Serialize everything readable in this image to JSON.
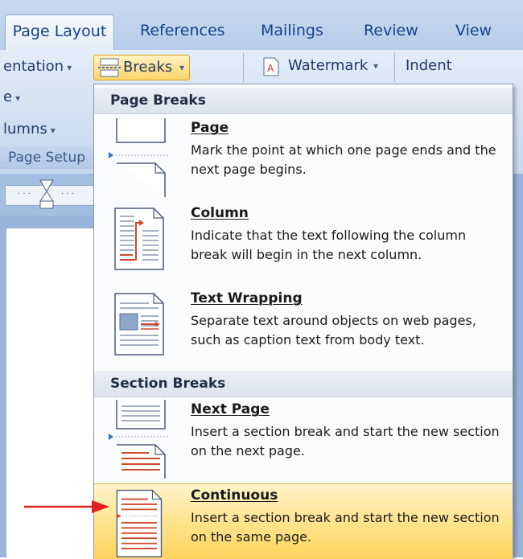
{
  "tabs": [
    {
      "label": "Page Layout",
      "active": true
    },
    {
      "label": "References"
    },
    {
      "label": "Mailings"
    },
    {
      "label": "Review"
    },
    {
      "label": "View"
    }
  ],
  "ribbon": {
    "orientation_label": "entation",
    "size_label": "e",
    "columns_label": "lumns",
    "breaks_label": "Breaks",
    "watermark_label": "Watermark",
    "indent_label": "Indent",
    "group_label": "Page Setup",
    "caret": "▾"
  },
  "menu": {
    "page_breaks_header": "Page Breaks",
    "section_breaks_header": "Section Breaks",
    "items": {
      "page": {
        "title": "Page",
        "desc": "Mark the point at which one page ends and the next page begins."
      },
      "column": {
        "title": "Column",
        "desc": "Indicate that the text following the column break will begin in the next column."
      },
      "text_wrapping": {
        "title": "Text Wrapping",
        "desc": "Separate text around objects on web pages, such as caption text from body text."
      },
      "next_page": {
        "title": "Next Page",
        "desc": "Insert a section break and start the new section on the next page."
      },
      "continuous": {
        "title": "Continuous",
        "desc": "Insert a section break and start the new section on the same page."
      }
    }
  },
  "colors": {
    "highlight": "#ffe28a",
    "accent_red": "#e02020",
    "ribbon_blue": "#c6d8ef"
  }
}
